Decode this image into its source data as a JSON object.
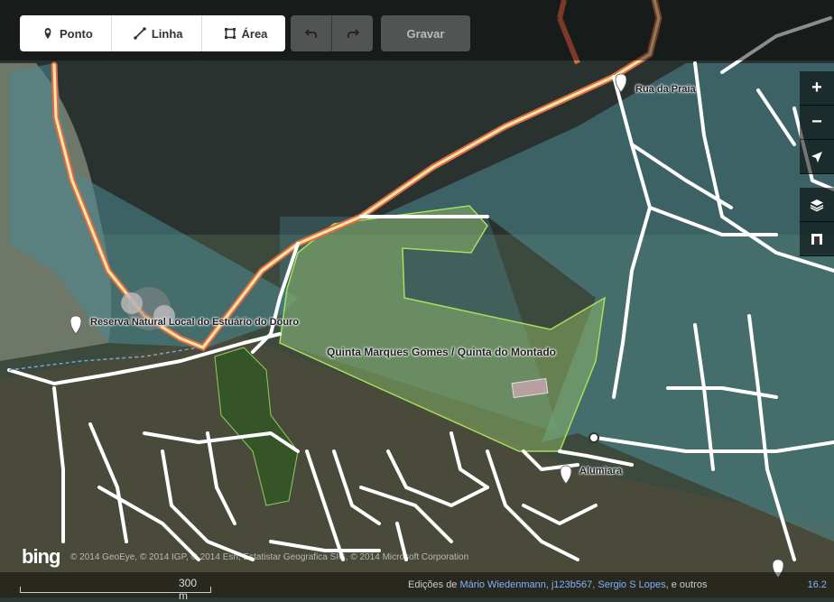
{
  "toolbar": {
    "modes": [
      {
        "label": "Ponto",
        "icon": "point-icon"
      },
      {
        "label": "Linha",
        "icon": "line-icon"
      },
      {
        "label": "Área",
        "icon": "area-icon"
      }
    ],
    "undo_icon": "undo-icon",
    "redo_icon": "redo-icon",
    "save_label": "Gravar"
  },
  "map_controls": {
    "zoom_in": "+",
    "zoom_out": "−",
    "geolocate_icon": "location-arrow-icon",
    "layers_icon": "layers-icon",
    "help_icon": "map-data-icon"
  },
  "labels": {
    "rua_da_praia": "Rua da Praia",
    "reserva": "Reserva Natural Local do Estuário do Douro",
    "quinta": "Quinta Marques Gomes / Quinta do Montado",
    "alumiara": "Alumiara"
  },
  "footer": {
    "scale": "300 m",
    "imagery_credit": "© 2014 GeoEye, © 2014 IGP, © 2014 Esri, Estatistar Geografica SIG, © 2014 Microsoft Corporation",
    "bing": "bing",
    "edits_prefix": "Edições de",
    "users": "Mário Wiedenmann, j123b567, Sergio S Lopes",
    "edits_suffix": ", e outros",
    "version": "16.2"
  },
  "colors": {
    "water_overlay": "#4a8a92",
    "park": "#7fb54a",
    "wood": "#2f5a23",
    "road": "#ffffff",
    "primary_road_outline": "#e06a4a",
    "primary_road_fill": "#f6e7a0"
  }
}
